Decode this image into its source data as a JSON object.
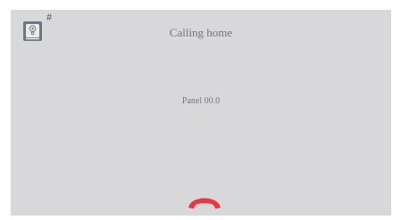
{
  "header": {
    "panel_icon": "door-panel-icon",
    "hash_symbol": "#",
    "title": "Calling home"
  },
  "main": {
    "panel_label": "Panel 00.0"
  },
  "controls": {
    "hangup_icon": "hang-up-icon",
    "hangup_color": "#e8373f"
  },
  "colors": {
    "background": "#d8d8da",
    "text": "#6f7780"
  }
}
